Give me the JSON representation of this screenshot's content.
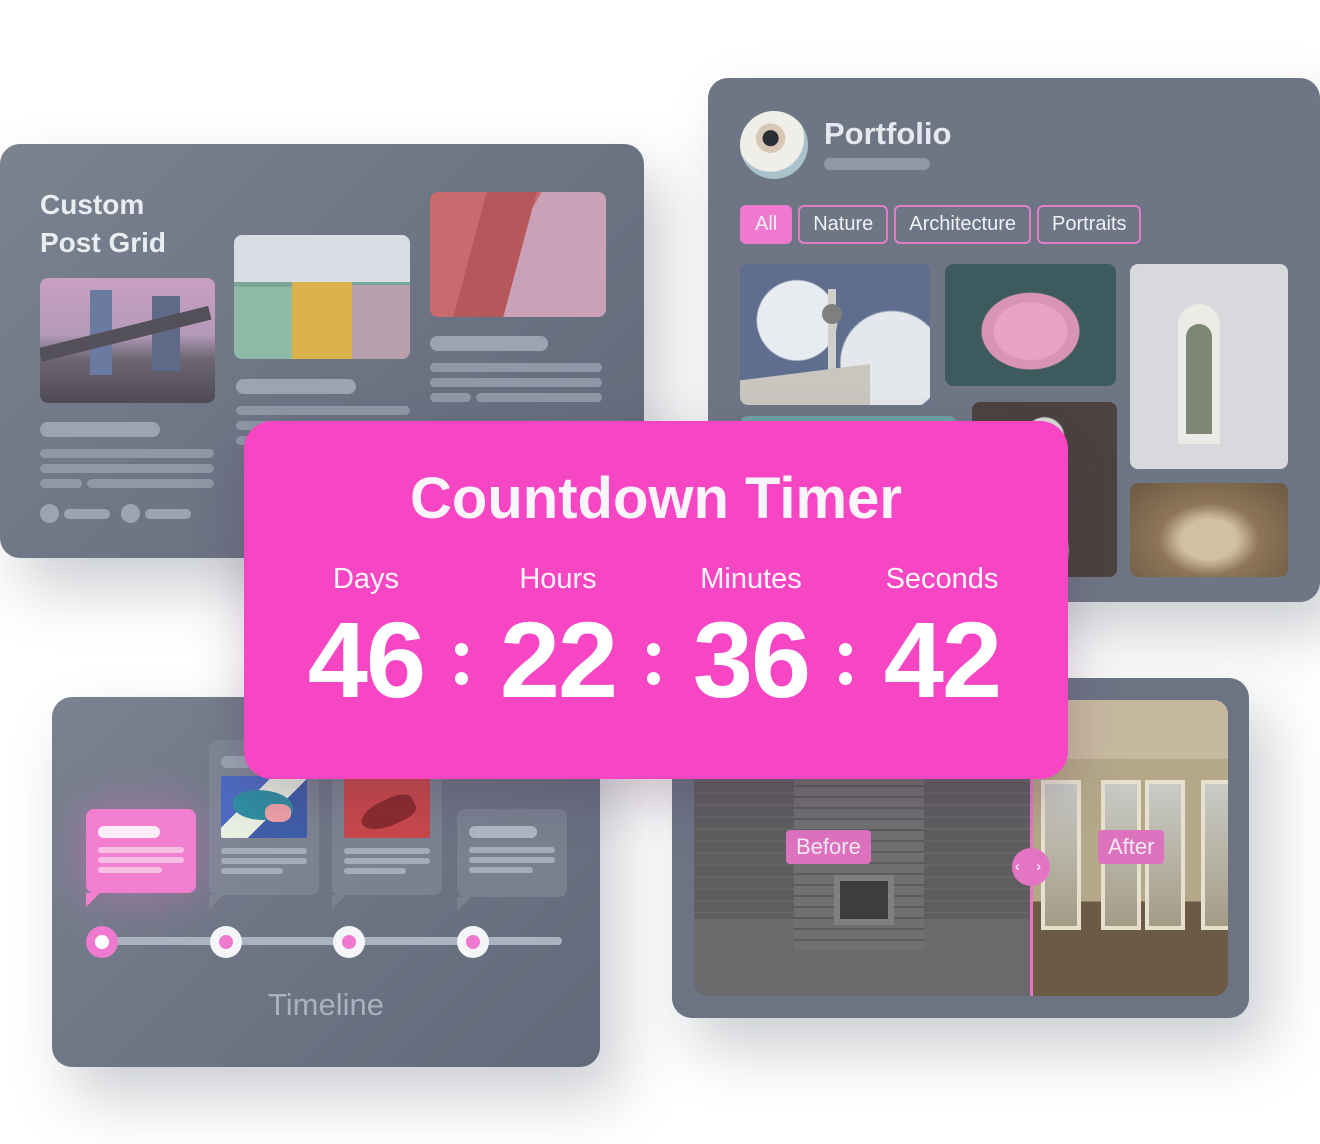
{
  "post_grid": {
    "title_line1": "Custom",
    "title_line2": "Post Grid",
    "photos": [
      "city-skyline-bridge-photo",
      "colorful-building-facade-photo",
      "red-bridge-tower-photo"
    ]
  },
  "portfolio": {
    "title": "Portfolio",
    "filters": [
      {
        "label": "All",
        "active": true
      },
      {
        "label": "Nature",
        "active": false
      },
      {
        "label": "Architecture",
        "active": false
      },
      {
        "label": "Portraits",
        "active": false
      }
    ],
    "photos": [
      "tv-tower-clouds-photo",
      "lotus-flower-photo",
      "arched-window-photo",
      "white-blossoms-photo",
      "arched-corridor-photo"
    ]
  },
  "countdown": {
    "title": "Countdown Timer",
    "units": [
      {
        "label": "Days",
        "value": "46"
      },
      {
        "label": "Hours",
        "value": "22"
      },
      {
        "label": "Minutes",
        "value": "36"
      },
      {
        "label": "Seconds",
        "value": "42"
      }
    ],
    "accent": "#f746c4"
  },
  "timeline": {
    "label": "Timeline",
    "active_index": 0,
    "node_count": 4
  },
  "before_after": {
    "before_label": "Before",
    "after_label": "After",
    "handle_icon": "‹ ›"
  },
  "colors": {
    "accent_pink": "#f746c4",
    "chip_pink": "#ef79cf",
    "card_gray": "#6e7685"
  }
}
